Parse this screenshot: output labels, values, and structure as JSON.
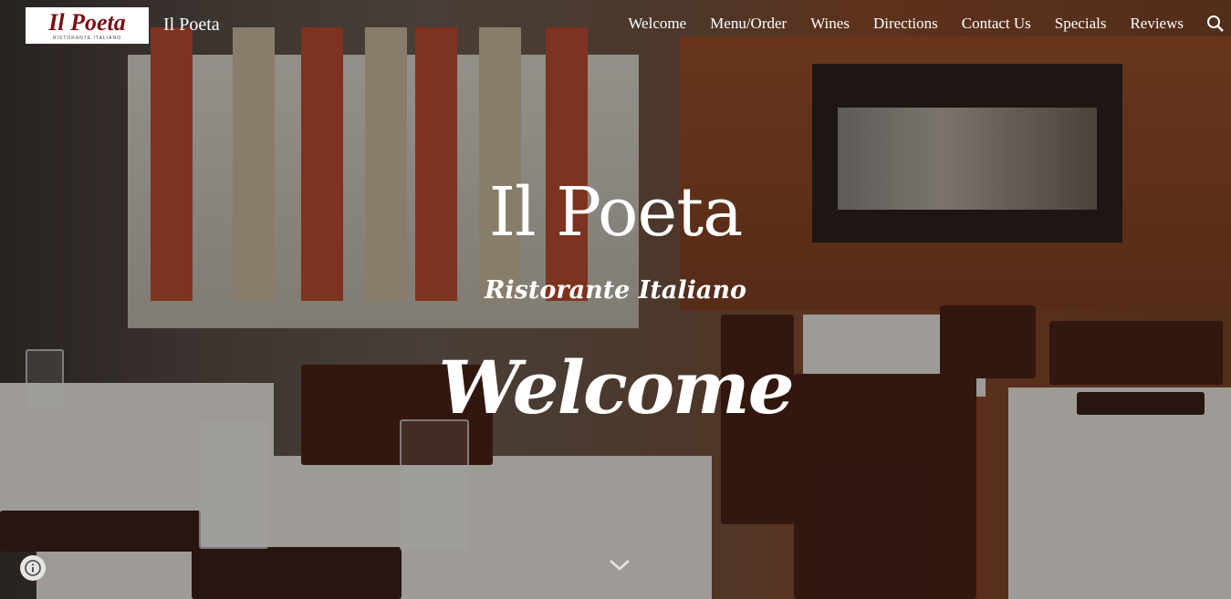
{
  "header": {
    "logo_text": "Il Poeta",
    "logo_subtext": "RISTORANTE ITALIANO",
    "site_title": "Il Poeta",
    "nav": [
      "Welcome",
      "Menu/Order",
      "Wines",
      "Directions",
      "Contact Us",
      "Specials",
      "Reviews"
    ],
    "search_icon": "search-icon"
  },
  "hero": {
    "title": "Il Poeta",
    "subtitle": "Ristorante Italiano",
    "heading": "Welcome",
    "scroll_icon": "chevron-down-icon",
    "info_icon": "info-icon"
  },
  "colors": {
    "logo_red": "#7a0f14",
    "text": "#ffffff"
  }
}
